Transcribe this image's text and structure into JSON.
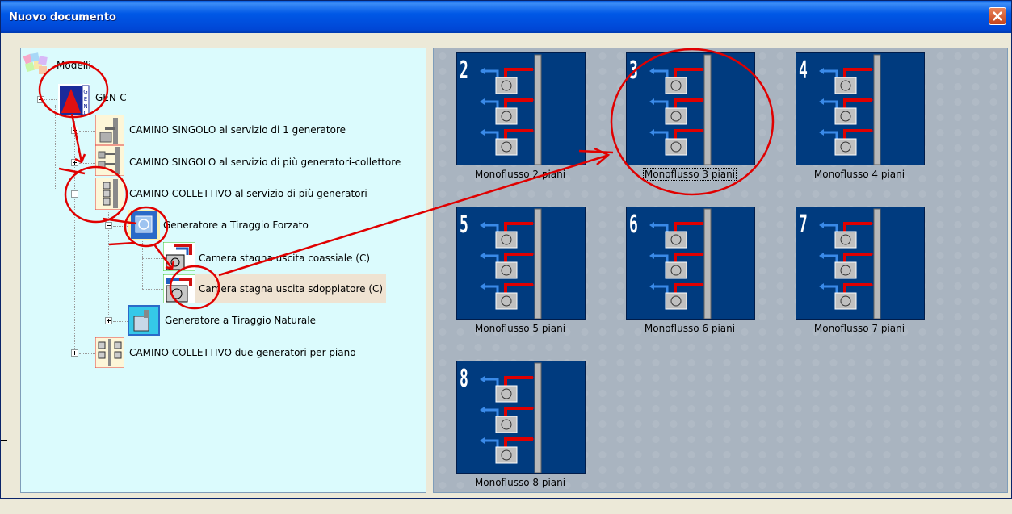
{
  "window": {
    "title": "Nuovo documento"
  },
  "tree": {
    "root_label": "Modelli",
    "gen_label": "GEN-C",
    "items": [
      {
        "label": "CAMINO  SINGOLO al servizio di 1 generatore"
      },
      {
        "label": "CAMINO  SINGOLO al servizio di più generatori-collettore"
      },
      {
        "label": "CAMINO COLLETTIVO al servizio di più generatori"
      },
      {
        "label": "Generatore a Tiraggio Forzato"
      },
      {
        "label": "Camera stagna uscita coassiale (C)"
      },
      {
        "label": "Camera stagna uscita sdoppiatore (C)"
      },
      {
        "label": "Generatore a Tiraggio Naturale"
      },
      {
        "label": "CAMINO COLLETTIVO due generatori per piano"
      }
    ]
  },
  "templates": [
    {
      "numeral": "2",
      "caption": "Monoflusso 2 piani"
    },
    {
      "numeral": "3",
      "caption": "Monoflusso 3 piani"
    },
    {
      "numeral": "4",
      "caption": "Monoflusso 4 piani"
    },
    {
      "numeral": "5",
      "caption": "Monoflusso 5 piani"
    },
    {
      "numeral": "6",
      "caption": "Monoflusso 6 piani"
    },
    {
      "numeral": "7",
      "caption": "Monoflusso 7 piani"
    },
    {
      "numeral": "8",
      "caption": "Monoflusso 8 piani"
    }
  ],
  "colors": {
    "titlebar": "#0054e3",
    "tree_bg": "#dbfbfd",
    "thumb_bg": "#003b7f",
    "annotation": "#e00000"
  }
}
